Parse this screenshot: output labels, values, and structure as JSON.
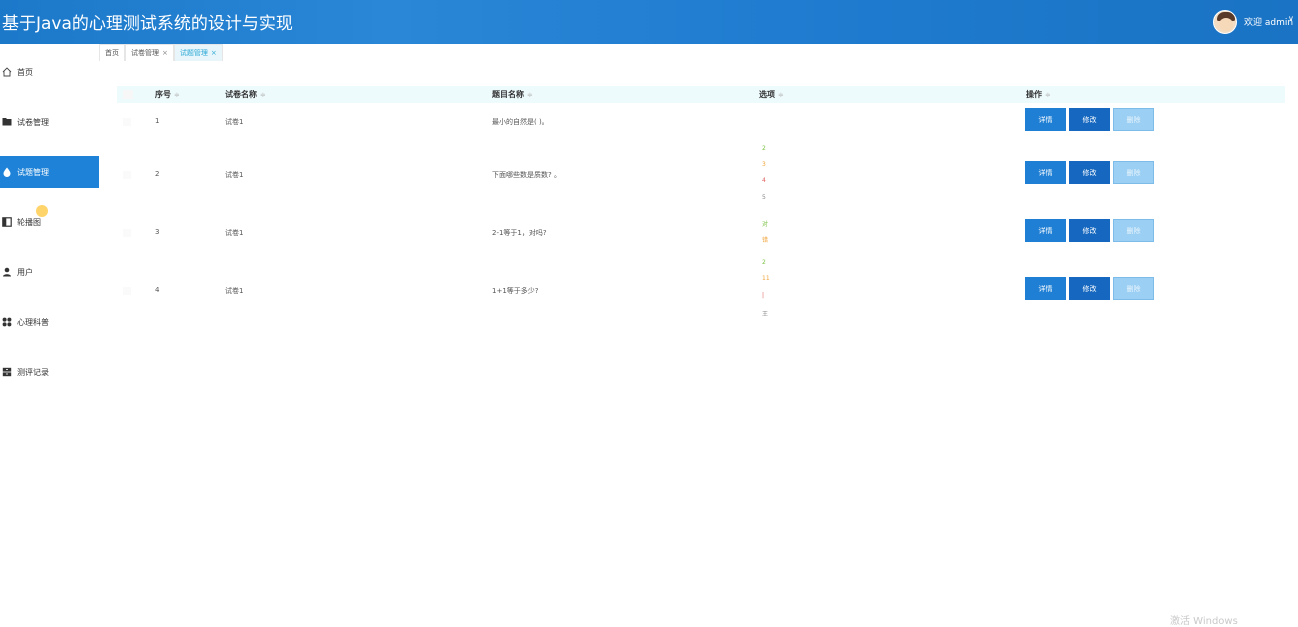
{
  "header": {
    "title": "基于Java的心理测试系统的设计与实现",
    "welcome": "欢迎 admin",
    "caret": "∨"
  },
  "sidebar": {
    "items": [
      {
        "label": "首页",
        "icon": "home-icon"
      },
      {
        "label": "试卷管理",
        "icon": "folder-icon"
      },
      {
        "label": "试题管理",
        "icon": "drop-icon",
        "active": true
      },
      {
        "label": "轮播图",
        "icon": "panel-icon"
      },
      {
        "label": "用户",
        "icon": "user-icon"
      },
      {
        "label": "心理科普",
        "icon": "grid-icon"
      },
      {
        "label": "测评记录",
        "icon": "archive-icon"
      }
    ]
  },
  "tabs": [
    {
      "label": "首页",
      "closable": false
    },
    {
      "label": "试卷管理",
      "closable": true
    },
    {
      "label": "试题管理",
      "closable": true,
      "active": true
    }
  ],
  "tab_close": "×",
  "table": {
    "headers": [
      "序号",
      "试卷名称",
      "题目名称",
      "选项",
      "操作"
    ],
    "sort_glyph": "≑",
    "rows": [
      {
        "index": "1",
        "paper": "试卷1",
        "question": "最小的自然是( )。",
        "options": []
      },
      {
        "index": "2",
        "paper": "试卷1",
        "question": "下面哪些数是质数? 。",
        "options": [
          "2",
          "3",
          "4",
          "5"
        ]
      },
      {
        "index": "3",
        "paper": "试卷1",
        "question": "2-1等于1，对吗?",
        "options": [
          "对",
          "错"
        ]
      },
      {
        "index": "4",
        "paper": "试卷1",
        "question": "1+1等于多少?",
        "options": [
          "2",
          "11",
          "|",
          "王"
        ]
      }
    ],
    "actions": {
      "detail": "详情",
      "edit": "修改",
      "delete": "删除"
    }
  },
  "watermark": "激活 Windows",
  "colors": {
    "header": "#1c78c9",
    "active_nav": "#1e83d8",
    "detail_button": "#1f7fd4",
    "edit_button": "#1567bf",
    "delete_button": "#9bcff3",
    "option_colors": [
      "#7ac142",
      "#f0a43a",
      "#e25c5c",
      "#8a8a8a"
    ]
  }
}
